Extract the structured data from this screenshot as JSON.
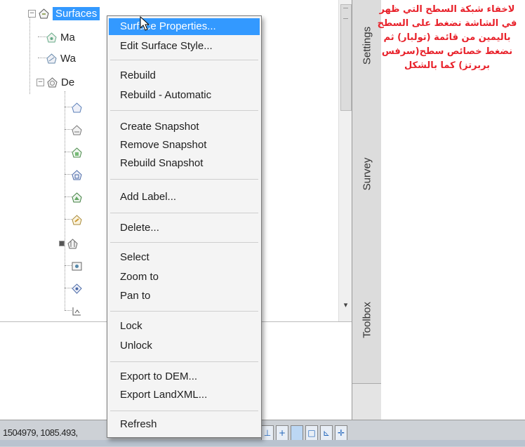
{
  "tree": {
    "root_label": "Surfaces",
    "children_truncated": [
      "Ma",
      "Wa",
      "De"
    ]
  },
  "side_tabs": [
    "Settings",
    "Survey",
    "Toolbox"
  ],
  "context_menu": {
    "items": [
      {
        "label": "Surface Properties..."
      },
      {
        "label": "Edit Surface Style..."
      },
      {
        "label": "Rebuild"
      },
      {
        "label": "Rebuild - Automatic"
      },
      {
        "label": "Create Snapshot"
      },
      {
        "label": "Remove Snapshot"
      },
      {
        "label": "Rebuild Snapshot"
      },
      {
        "label": "Add Label..."
      },
      {
        "label": "Delete..."
      },
      {
        "label": "Select"
      },
      {
        "label": "Zoom to"
      },
      {
        "label": "Pan to"
      },
      {
        "label": "Lock"
      },
      {
        "label": "Unlock"
      },
      {
        "label": "Export to DEM..."
      },
      {
        "label": "Export LandXML..."
      },
      {
        "label": "Refresh"
      }
    ]
  },
  "status_bar": {
    "coordinates": "1504979, 1085.493,"
  },
  "annotation": {
    "text": "لاخفاء شبكة السطح التي ظهر في الشاشة نضغط على السطح باليمين من قائمة (تولبار) ثم نضغط خصائص سطح(سرفس بربرتز) كما بالشكل"
  },
  "colors": {
    "selection": "#3399ff",
    "annotation": "#e8222b"
  }
}
